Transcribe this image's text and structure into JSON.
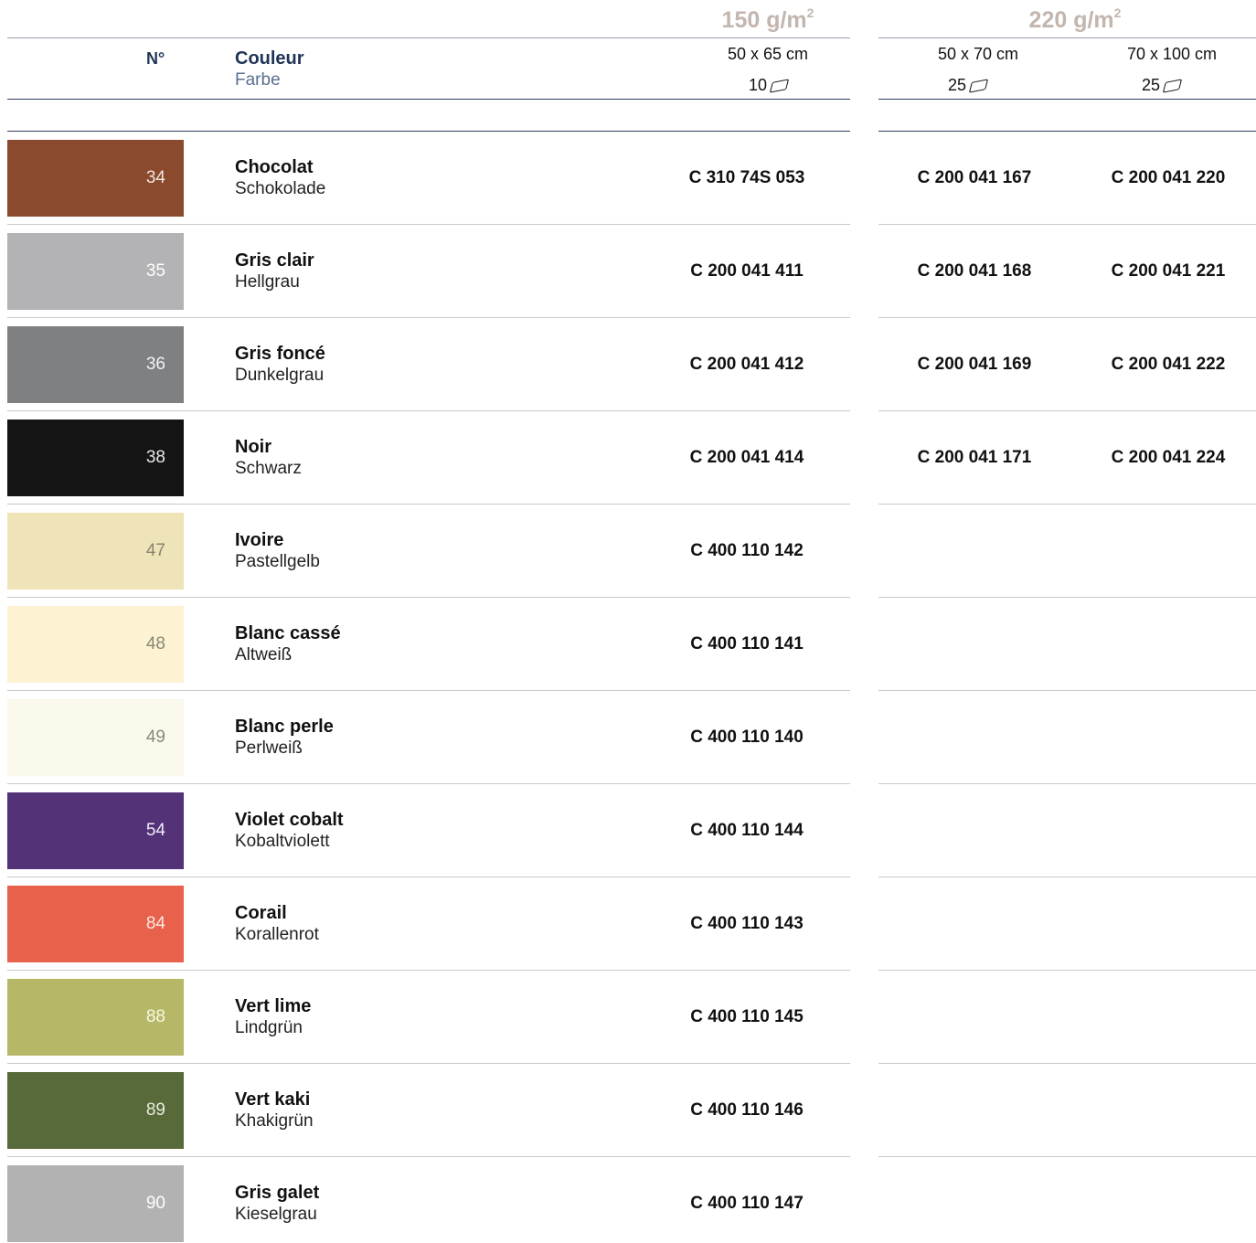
{
  "header": {
    "no_label": "N°",
    "couleur_label": "Couleur",
    "farbe_label": "Farbe",
    "groups": [
      {
        "weight": "150 g/m",
        "weight_sup": "2",
        "formats": [
          {
            "size": "50 x 65 cm",
            "qty": "10"
          }
        ]
      },
      {
        "weight": "220 g/m",
        "weight_sup": "2",
        "formats": [
          {
            "size": "50 x 70 cm",
            "qty": "25"
          },
          {
            "size": "70 x 100 cm",
            "qty": "25"
          }
        ]
      }
    ]
  },
  "rows": [
    {
      "no": "34",
      "fr": "Chocolat",
      "de": "Schokolade",
      "swatch": "#8b4a2e",
      "num_color": "#f2e6de",
      "c150": "C 310 74S 053",
      "c220a": "C 200 041 167",
      "c220b": "C 200 041 220"
    },
    {
      "no": "35",
      "fr": "Gris clair",
      "de": "Hellgrau",
      "swatch": "#b3b3b5",
      "num_color": "#ffffff",
      "c150": "C 200 041 411",
      "c220a": "C 200 041 168",
      "c220b": "C 200 041 221"
    },
    {
      "no": "36",
      "fr": "Gris foncé",
      "de": "Dunkelgrau",
      "swatch": "#7f8082",
      "num_color": "#f3f3f3",
      "c150": "C 200 041 412",
      "c220a": "C 200 041 169",
      "c220b": "C 200 041 222"
    },
    {
      "no": "38",
      "fr": "Noir",
      "de": "Schwarz",
      "swatch": "#141414",
      "num_color": "#e8e8e8",
      "c150": "C 200 041 414",
      "c220a": "C 200 041 171",
      "c220b": "C 200 041 224"
    },
    {
      "no": "47",
      "fr": "Ivoire",
      "de": "Pastellgelb",
      "swatch": "#efe4b8",
      "num_color": "#8a8470",
      "c150": "C 400 110 142",
      "c220a": "",
      "c220b": ""
    },
    {
      "no": "48",
      "fr": "Blanc cassé",
      "de": "Altweiß",
      "swatch": "#fdf3d3",
      "num_color": "#8a8778",
      "c150": "C 400 110 141",
      "c220a": "",
      "c220b": ""
    },
    {
      "no": "49",
      "fr": "Blanc perle",
      "de": "Perlweiß",
      "swatch": "#fbf8ec",
      "num_color": "#8a8880",
      "c150": "C 400 110 140",
      "c220a": "",
      "c220b": ""
    },
    {
      "no": "54",
      "fr": "Violet cobalt",
      "de": "Kobaltviolett",
      "swatch": "#533278",
      "num_color": "#f1ecf7",
      "c150": "C 400 110 144",
      "c220a": "",
      "c220b": ""
    },
    {
      "no": "84",
      "fr": "Corail",
      "de": "Korallenrot",
      "swatch": "#e8614a",
      "num_color": "#fde9e4",
      "c150": "C 400 110 143",
      "c220a": "",
      "c220b": ""
    },
    {
      "no": "88",
      "fr": "Vert lime",
      "de": "Lindgrün",
      "swatch": "#b6b867",
      "num_color": "#f7f7e6",
      "c150": "C 400 110 145",
      "c220a": "",
      "c220b": ""
    },
    {
      "no": "89",
      "fr": "Vert kaki",
      "de": "Khakigrün",
      "swatch": "#596a3a",
      "num_color": "#e8eddd",
      "c150": "C 400 110 146",
      "c220a": "",
      "c220b": ""
    },
    {
      "no": "90",
      "fr": "Gris galet",
      "de": "Kieselgrau",
      "swatch": "#b2b2b3",
      "num_color": "#ffffff",
      "c150": "C 400 110 147",
      "c220a": "",
      "c220b": ""
    }
  ]
}
